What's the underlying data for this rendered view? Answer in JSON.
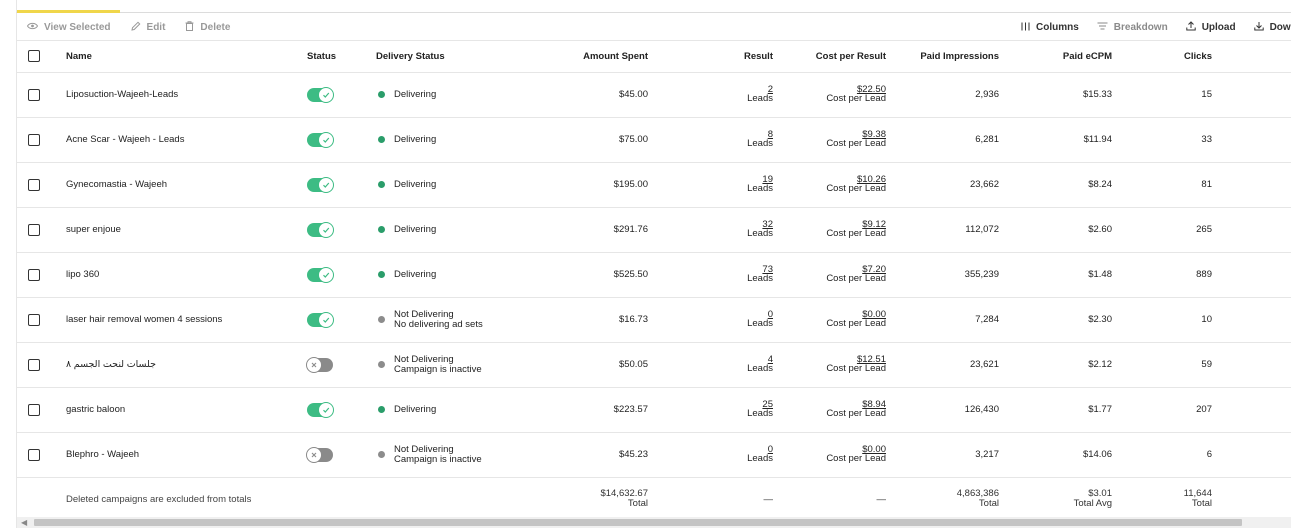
{
  "toolbar": {
    "view_selected": "View Selected",
    "edit": "Edit",
    "delete": "Delete",
    "columns": "Columns",
    "breakdown": "Breakdown",
    "upload": "Upload",
    "download": "Downl"
  },
  "table": {
    "headers": {
      "name": "Name",
      "status": "Status",
      "delivery_status": "Delivery Status",
      "amount_spent": "Amount Spent",
      "result": "Result",
      "cost_per_result": "Cost per Result",
      "paid_impressions": "Paid Impressions",
      "paid_ecpm": "Paid eCPM",
      "clicks": "Clicks"
    },
    "rows": [
      {
        "name": "Liposuction-Wajeeh-Leads",
        "active": true,
        "delivery": "Delivering",
        "delivery_sub": "",
        "amount": "$45.00",
        "result": "2",
        "result_unit": "Leads",
        "cpr": "$22.50",
        "cpr_unit": "Cost per Lead",
        "impressions": "2,936",
        "ecpm": "$15.33",
        "clicks": "15"
      },
      {
        "name": "Acne Scar - Wajeeh - Leads",
        "active": true,
        "delivery": "Delivering",
        "delivery_sub": "",
        "amount": "$75.00",
        "result": "8",
        "result_unit": "Leads",
        "cpr": "$9.38",
        "cpr_unit": "Cost per Lead",
        "impressions": "6,281",
        "ecpm": "$11.94",
        "clicks": "33"
      },
      {
        "name": "Gynecomastia - Wajeeh",
        "active": true,
        "delivery": "Delivering",
        "delivery_sub": "",
        "amount": "$195.00",
        "result": "19",
        "result_unit": "Leads",
        "cpr": "$10.26",
        "cpr_unit": "Cost per Lead",
        "impressions": "23,662",
        "ecpm": "$8.24",
        "clicks": "81"
      },
      {
        "name": "super enjoue",
        "active": true,
        "delivery": "Delivering",
        "delivery_sub": "",
        "amount": "$291.76",
        "result": "32",
        "result_unit": "Leads",
        "cpr": "$9.12",
        "cpr_unit": "Cost per Lead",
        "impressions": "112,072",
        "ecpm": "$2.60",
        "clicks": "265"
      },
      {
        "name": "lipo 360",
        "active": true,
        "delivery": "Delivering",
        "delivery_sub": "",
        "amount": "$525.50",
        "result": "73",
        "result_unit": "Leads",
        "cpr": "$7.20",
        "cpr_unit": "Cost per Lead",
        "impressions": "355,239",
        "ecpm": "$1.48",
        "clicks": "889"
      },
      {
        "name": "laser hair removal women 4 sessions",
        "active": true,
        "delivery": "Not Delivering",
        "delivery_sub": "No delivering ad sets",
        "amount": "$16.73",
        "result": "0",
        "result_unit": "Leads",
        "cpr": "$0.00",
        "cpr_unit": "Cost per Lead",
        "impressions": "7,284",
        "ecpm": "$2.30",
        "clicks": "10"
      },
      {
        "name": "جلسات لنحت الجسم ٨",
        "active": false,
        "delivery": "Not Delivering",
        "delivery_sub": "Campaign is inactive",
        "amount": "$50.05",
        "result": "4",
        "result_unit": "Leads",
        "cpr": "$12.51",
        "cpr_unit": "Cost per Lead",
        "impressions": "23,621",
        "ecpm": "$2.12",
        "clicks": "59"
      },
      {
        "name": "gastric baloon",
        "active": true,
        "delivery": "Delivering",
        "delivery_sub": "",
        "amount": "$223.57",
        "result": "25",
        "result_unit": "Leads",
        "cpr": "$8.94",
        "cpr_unit": "Cost per Lead",
        "impressions": "126,430",
        "ecpm": "$1.77",
        "clicks": "207"
      },
      {
        "name": "Blephro - Wajeeh",
        "active": false,
        "delivery": "Not Delivering",
        "delivery_sub": "Campaign is inactive",
        "amount": "$45.23",
        "result": "0",
        "result_unit": "Leads",
        "cpr": "$0.00",
        "cpr_unit": "Cost per Lead",
        "impressions": "3,217",
        "ecpm": "$14.06",
        "clicks": "6"
      }
    ],
    "totals": {
      "note": "Deleted campaigns are excluded from totals",
      "amount": "$14,632.67",
      "amount_label": "Total",
      "result": "—",
      "cpr": "—",
      "impressions": "4,863,386",
      "impressions_label": "Total",
      "ecpm": "$3.01",
      "ecpm_label": "Total Avg",
      "clicks": "11,644",
      "clicks_label": "Total"
    }
  },
  "colors": {
    "accent": "#f0d64a",
    "toggle_on": "#3dbc84",
    "toggle_off": "#8a8a8a",
    "delivering": "#2a9d6a",
    "not_delivering": "#8c8c8c"
  }
}
